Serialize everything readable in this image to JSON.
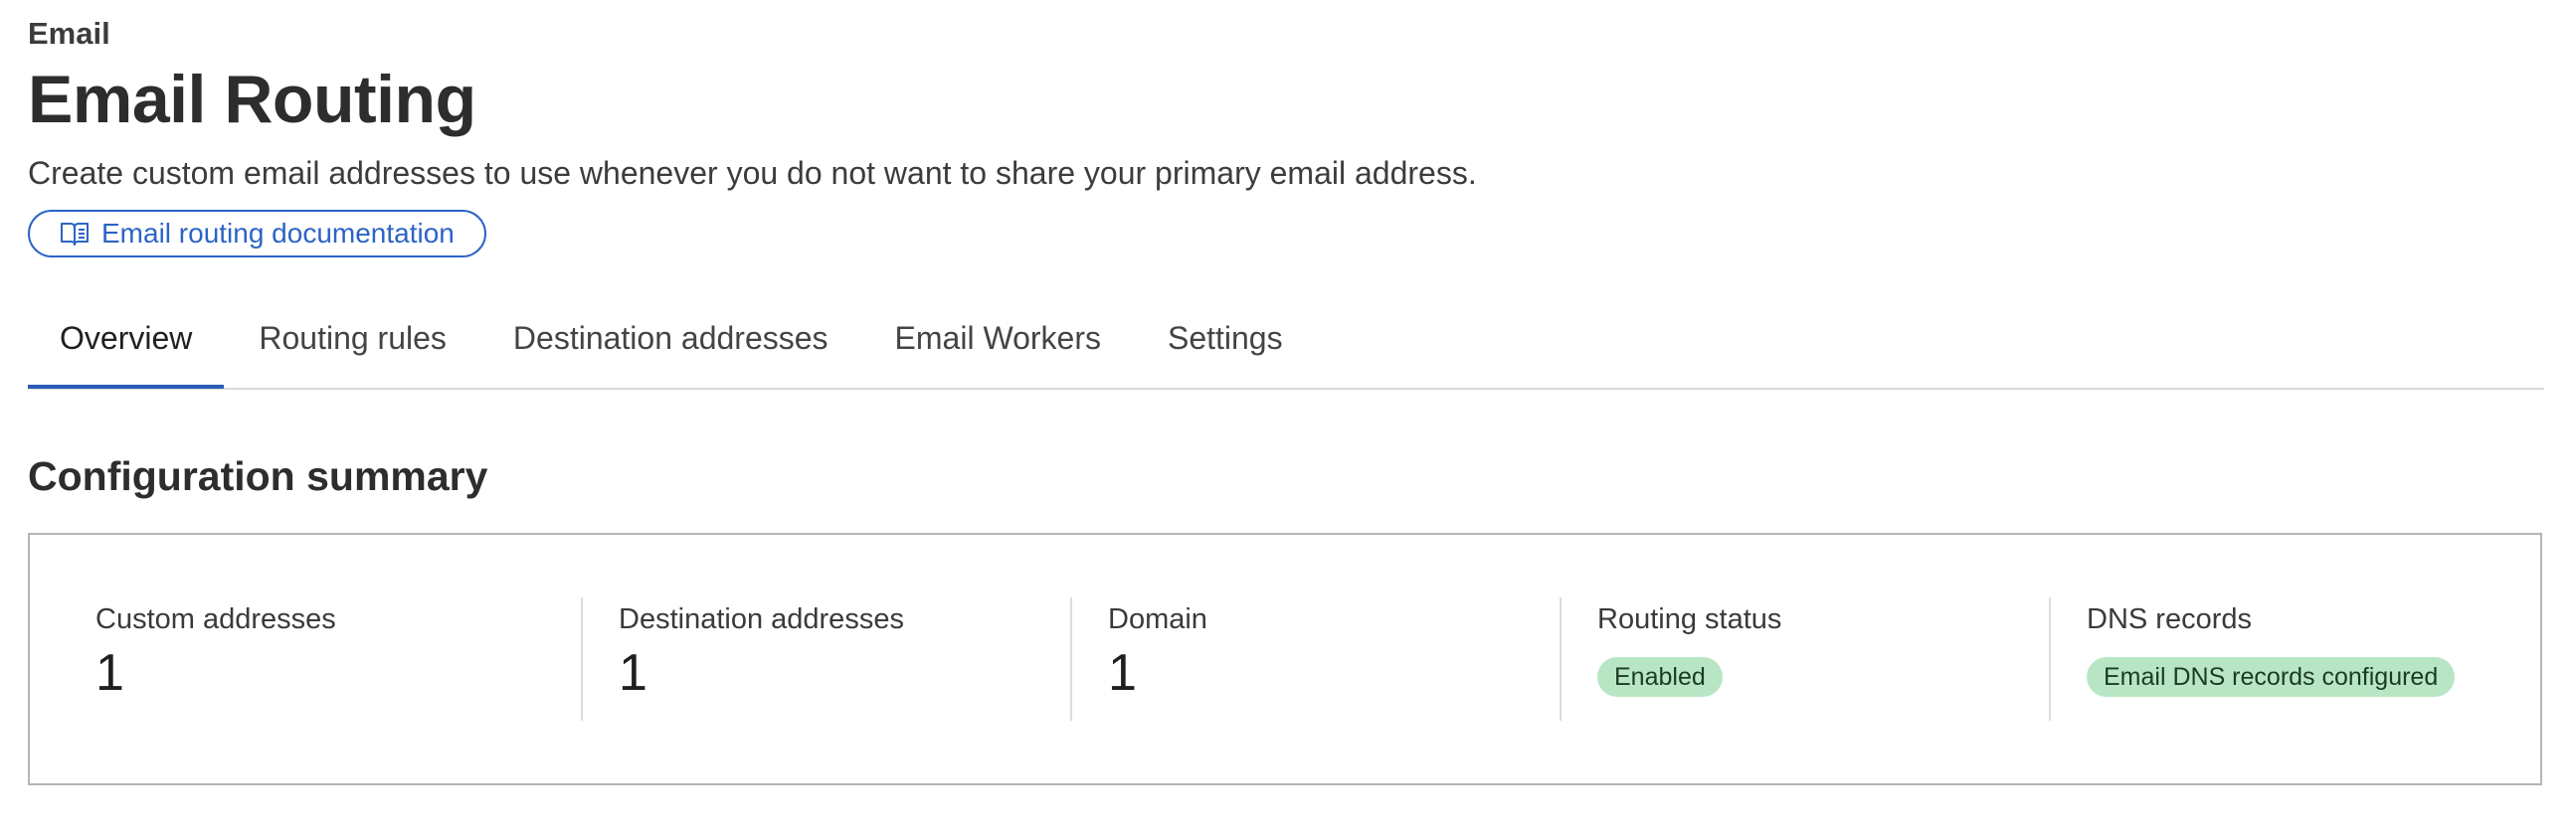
{
  "breadcrumb": "Email",
  "page": {
    "title": "Email Routing",
    "description": "Create custom email addresses to use whenever you do not want to share your primary email address.",
    "doc_link": {
      "label": "Email routing documentation",
      "icon": "book-open-icon"
    }
  },
  "tabs": [
    {
      "label": "Overview",
      "active": true
    },
    {
      "label": "Routing rules",
      "active": false
    },
    {
      "label": "Destination addresses",
      "active": false
    },
    {
      "label": "Email Workers",
      "active": false
    },
    {
      "label": "Settings",
      "active": false
    }
  ],
  "summary": {
    "title": "Configuration summary",
    "stats": [
      {
        "label": "Custom addresses",
        "value": "1"
      },
      {
        "label": "Destination addresses",
        "value": "1"
      },
      {
        "label": "Domain",
        "value": "1"
      },
      {
        "label": "Routing status",
        "badge": "Enabled"
      },
      {
        "label": "DNS records",
        "badge": "Email DNS records configured"
      }
    ]
  },
  "colors": {
    "accent": "#2c64c6",
    "badge_bg": "#b8e6c4",
    "card_border": "#b5b5b5"
  }
}
